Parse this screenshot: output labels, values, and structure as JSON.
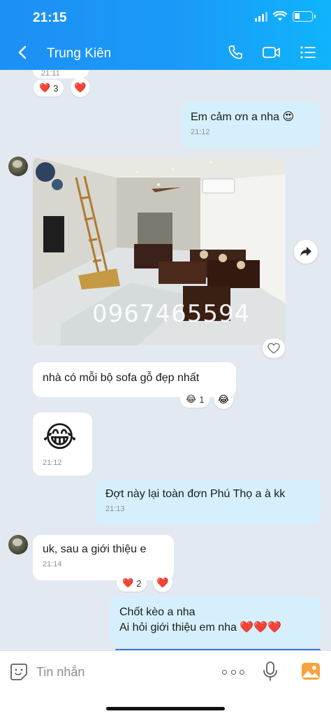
{
  "status_bar": {
    "time": "21:15"
  },
  "header": {
    "title": "Trung Kiên"
  },
  "messages": [
    {
      "type": "text",
      "direction": "in",
      "time": "21:11",
      "reaction_count": "3"
    },
    {
      "type": "text",
      "direction": "out",
      "text": "Em cảm ơn a nha 😍",
      "time": "21:12"
    },
    {
      "type": "image",
      "direction": "in",
      "watermark": "0967465594"
    },
    {
      "type": "text",
      "direction": "in",
      "text": "nhà có mỗi bộ sofa gỗ đẹp nhất",
      "reaction_count": "1"
    },
    {
      "type": "emoji",
      "direction": "in",
      "time": "21:12"
    },
    {
      "type": "text",
      "direction": "out",
      "text": "Đợt này lại toàn đơn Phú Thọ a à kk",
      "time": "21:13"
    },
    {
      "type": "text",
      "direction": "in",
      "text": "uk, sau a giới thiệu e",
      "time": "21:14",
      "reaction_count": "2"
    },
    {
      "type": "text",
      "direction": "out",
      "line1": "Chốt kèo a nha",
      "line2": "Ai hỏi giới thiệu em nha ❤️❤️❤️"
    }
  ],
  "composer": {
    "placeholder": "Tin nhắn"
  },
  "colors": {
    "header_start": "#1d8ff5",
    "header_end": "#0fb4fb",
    "outgoing_bubble": "#d5f0fc",
    "background": "#e2e9f1"
  }
}
